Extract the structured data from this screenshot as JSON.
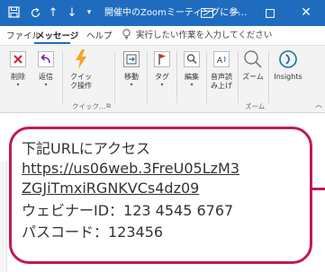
{
  "titlebar": {
    "title": "開催中のZoomミーティングに参…",
    "up_arrow": "↑",
    "down_arrow": "↓",
    "more": "▾",
    "minimize": "─",
    "close": "✕"
  },
  "menu": {
    "file": "ファイル",
    "message": "メッセージ",
    "help": "ヘルプ",
    "tellme": "実行したい作業を入力してください"
  },
  "ribbon": {
    "buttons": [
      {
        "label": "削除",
        "icon": "delete-x-icon"
      },
      {
        "label": "返信",
        "icon": "reply-arrow-icon"
      },
      {
        "label": "クイック操作",
        "icon": "lightning-icon"
      },
      {
        "label": "移動",
        "icon": "move-icon"
      },
      {
        "label": "タグ",
        "icon": "flag-icon"
      },
      {
        "label": "編集",
        "icon": "search-icon"
      },
      {
        "label": "音声読み上げ",
        "icon": "read-aloud-icon"
      },
      {
        "label": "ズーム",
        "icon": "zoom-icon"
      },
      {
        "label": "Insights",
        "icon": "insights-icon"
      }
    ],
    "groups": {
      "quick": "クイック…",
      "zoom": "ズーム"
    },
    "accent_colors": {
      "red": "#c62828",
      "blue": "#1f6cbf",
      "orange": "#f5a623",
      "teal": "#0f7b8a"
    }
  },
  "message": {
    "heading": "下記URLにアクセス",
    "url_line1": "https://us06web.3FreU05LzM3",
    "url_line2": "ZGJiTmxiRGNKVCs4dz09",
    "webinar_id": "ウェビナーID：123 4545 6767",
    "passcode": "パスコード：123456"
  },
  "highlight_color": "#c2185b"
}
